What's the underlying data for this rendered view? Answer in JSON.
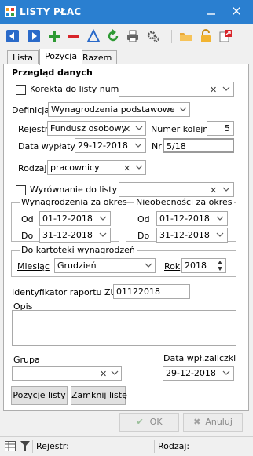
{
  "window": {
    "title": "LISTY PŁAC"
  },
  "toolbar": {
    "icons": [
      "arrow-left-icon",
      "arrow-right-icon",
      "plus-icon",
      "minus-icon",
      "triangle-icon",
      "refresh-icon",
      "printer-icon",
      "gears-icon",
      "folder-icon",
      "lock-icon",
      "export-icon"
    ]
  },
  "tabs": [
    "Lista",
    "Pozycja",
    "Razem"
  ],
  "section_title": "Przegląd danych",
  "korekta": {
    "label": "Korekta do listy numer",
    "value": ""
  },
  "definicja": {
    "label": "Definicja",
    "value": "Wynagrodzenia podstawowe"
  },
  "rejestr": {
    "label": "Rejestr",
    "value": "Fundusz osobowy"
  },
  "numer_kolejny": {
    "label": "Numer kolejny",
    "value": "5"
  },
  "data_wyplaty": {
    "label": "Data wypłaty",
    "value": "29-12-2018"
  },
  "nr": {
    "label": "Nr",
    "value": "5/18"
  },
  "rodzaj": {
    "label": "Rodzaj",
    "value": "pracownicy"
  },
  "wyrownanie": {
    "label": "Wyrównanie do listy nr",
    "value": ""
  },
  "wynagrodzenia_okres": {
    "title": "Wynagrodzenia za okres",
    "od_label": "Od",
    "od": "01-12-2018",
    "do_label": "Do",
    "do": "31-12-2018"
  },
  "nieobecnosci_okres": {
    "title": "Nieobecności za okres",
    "od_label": "Od",
    "od": "01-12-2018",
    "do_label": "Do",
    "do": "31-12-2018"
  },
  "kartoteki": {
    "title": "Do kartoteki  wynagrodzeń",
    "miesiac_label": "Miesiąc",
    "miesiac": "Grudzień",
    "rok_label": "Rok",
    "rok": "2018"
  },
  "zus": {
    "label": "Identyfikator raportu ZUS",
    "value": "01122018"
  },
  "opis": {
    "label": "Opis",
    "value": ""
  },
  "grupa": {
    "label": "Grupa",
    "value": ""
  },
  "zaliczka": {
    "label": "Data wpł.zaliczki",
    "value": "29-12-2018"
  },
  "buttons": {
    "pozycje": "Pozycje listy",
    "zamknij": "Zamknij listę",
    "ok": "OK",
    "anuluj": "Anuluj"
  },
  "status": {
    "rejestr_label": "Rejestr:",
    "rejestr": "",
    "rodzaj_label": "Rodzaj:",
    "rodzaj": ""
  },
  "colors": {
    "titlebar": "#2a7fd0",
    "accent_green": "#2e9a34",
    "accent_red": "#d8252a",
    "accent_blue": "#2a6ac9"
  }
}
